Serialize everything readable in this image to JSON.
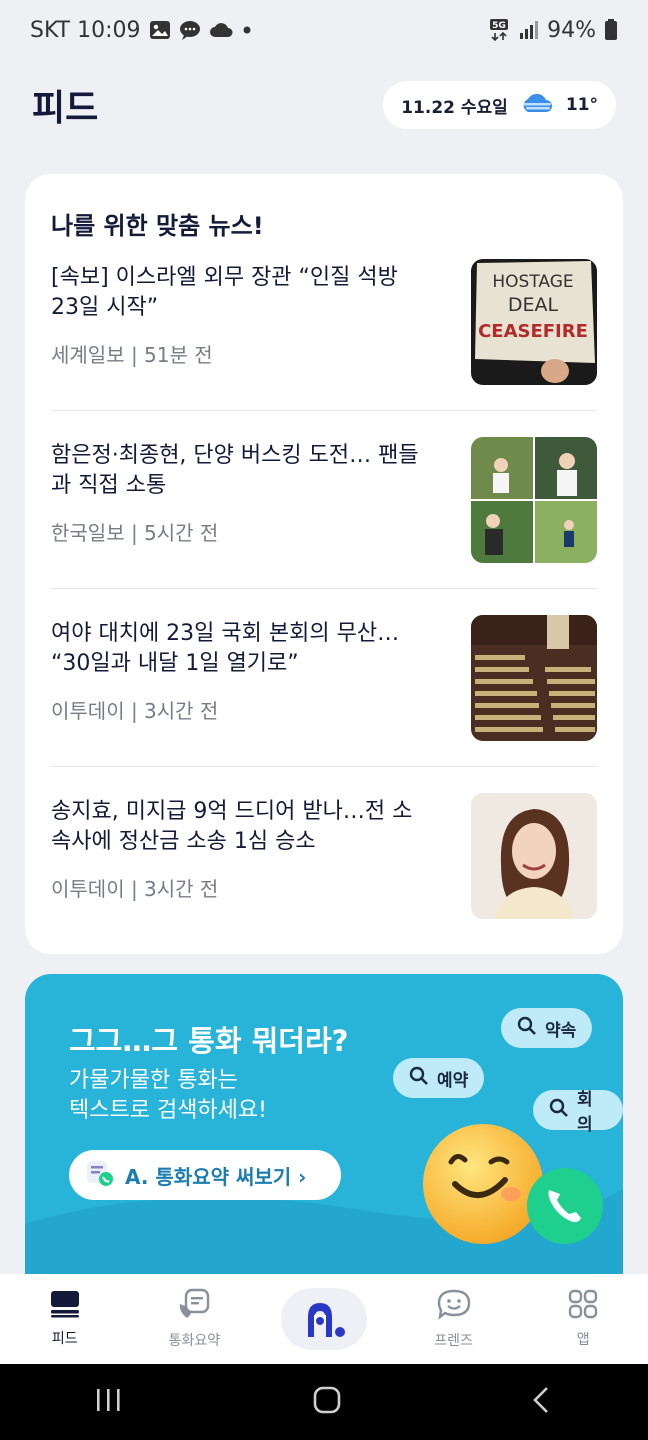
{
  "status_bar": {
    "time": "SKT 10:09",
    "battery": "94%",
    "network": "5G",
    "icons": [
      "image-icon",
      "chat-icon",
      "cloud-icon",
      "dot-icon",
      "network-5g-icon",
      "signal-icon",
      "battery-icon"
    ]
  },
  "header": {
    "title": "피드",
    "weather": {
      "date": "11.22 수요일",
      "temp": "11°",
      "icon": "cloudy-weather-icon"
    }
  },
  "news": {
    "heading": "나를 위한 맞춤 뉴스!",
    "items": [
      {
        "title": "[속보] 이스라엘 외무 장관 “인질 석방 23일 시작”",
        "meta": "세계일보 | 51분 전",
        "thumb_text": [
          "HOSTAGE",
          "DEAL",
          "CEASEFIRE"
        ]
      },
      {
        "title": "함은정·최종현, 단양 버스킹 도전… 팬들과 직접 소통",
        "meta": "한국일보 | 5시간 전"
      },
      {
        "title": "여야 대치에 23일 국회 본회의 무산… “30일과 내달 1일 열기로”",
        "meta": "이투데이 | 3시간 전"
      },
      {
        "title": "송지효, 미지급 9억 드디어 받나…전 소속사에 정산금 소송 1심 승소",
        "meta": "이투데이 | 3시간 전"
      }
    ]
  },
  "promo": {
    "title": "그그…그 통화 뭐더라?",
    "subtitle_line1": "가물가물한 통화는",
    "subtitle_line2": "텍스트로 검색하세요!",
    "button_label": "A. 통화요약 써보기 ›",
    "chips": [
      "약속",
      "예약",
      "회의"
    ]
  },
  "bottom_nav": {
    "items": [
      {
        "label": "피드",
        "icon": "feed-icon"
      },
      {
        "label": "통화요약",
        "icon": "call-summary-icon"
      },
      {
        "label": "",
        "icon": "a-dot-logo-icon"
      },
      {
        "label": "프렌즈",
        "icon": "friends-icon"
      },
      {
        "label": "앱",
        "icon": "apps-grid-icon"
      }
    ]
  },
  "colors": {
    "primary_dark": "#141a3a",
    "promo_bg": "#28b3d9",
    "chip_bg": "#bfeaf7",
    "call_green": "#1ecf8e",
    "meta_gray": "#777c88"
  }
}
